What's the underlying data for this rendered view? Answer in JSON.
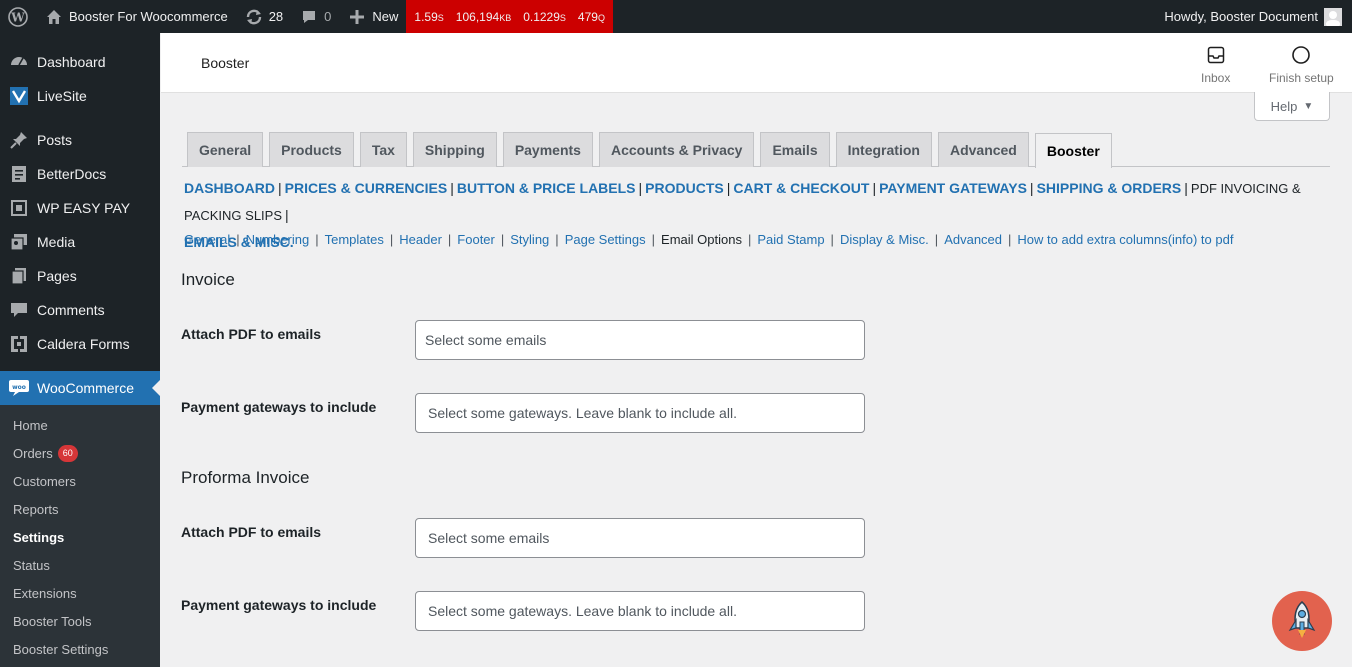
{
  "adminbar": {
    "site_name": "Booster For Woocommerce",
    "updates_count": "28",
    "comments_count": "0",
    "new_label": "New",
    "qm": {
      "time": "1.59",
      "time_unit": "S",
      "memory": "106,194",
      "memory_unit": "KB",
      "db_time": "0.1229",
      "db_time_unit": "S",
      "queries": "479",
      "queries_unit": "Q"
    },
    "howdy": "Howdy, Booster Document"
  },
  "sidebar": {
    "items": [
      {
        "label": "Dashboard",
        "icon": "dashboard-icon"
      },
      {
        "label": "LiveSite",
        "icon": "livesite-icon"
      },
      {
        "label": "Posts",
        "icon": "pin-icon"
      },
      {
        "label": "BetterDocs",
        "icon": "docs-icon"
      },
      {
        "label": "WP EASY PAY",
        "icon": "square-icon"
      },
      {
        "label": "Media",
        "icon": "media-icon"
      },
      {
        "label": "Pages",
        "icon": "pages-icon"
      },
      {
        "label": "Comments",
        "icon": "comment-icon"
      },
      {
        "label": "Caldera Forms",
        "icon": "caldera-icon"
      },
      {
        "label": "WooCommerce",
        "icon": "woo-icon"
      }
    ],
    "submenu": [
      {
        "label": "Home"
      },
      {
        "label": "Orders",
        "badge": "60"
      },
      {
        "label": "Customers"
      },
      {
        "label": "Reports"
      },
      {
        "label": "Settings"
      },
      {
        "label": "Status"
      },
      {
        "label": "Extensions"
      },
      {
        "label": "Booster Tools"
      },
      {
        "label": "Booster Settings"
      }
    ]
  },
  "header": {
    "title": "Booster",
    "inbox_label": "Inbox",
    "finish_setup_label": "Finish setup",
    "help_label": "Help"
  },
  "tabs": [
    "General",
    "Products",
    "Tax",
    "Shipping",
    "Payments",
    "Accounts & Privacy",
    "Emails",
    "Integration",
    "Advanced",
    "Booster"
  ],
  "sections": [
    "DASHBOARD",
    "PRICES & CURRENCIES",
    "BUTTON & PRICE LABELS",
    "PRODUCTS",
    "CART & CHECKOUT",
    "PAYMENT GATEWAYS",
    "SHIPPING & ORDERS",
    "PDF INVOICING & PACKING SLIPS",
    "EMAILS & MISC."
  ],
  "subsections": [
    "General",
    "Numbering",
    "Templates",
    "Header",
    "Footer",
    "Styling",
    "Page Settings",
    "Email Options",
    "Paid Stamp",
    "Display & Misc.",
    "Advanced",
    "How to add extra columns(info) to pdf"
  ],
  "form": {
    "invoice_heading": "Invoice",
    "proforma_heading": "Proforma Invoice",
    "attach_label": "Attach PDF to emails",
    "gateways_label": "Payment gateways to include",
    "emails_placeholder": "Select some emails",
    "gateways_placeholder": "Select some gateways. Leave blank to include all."
  }
}
